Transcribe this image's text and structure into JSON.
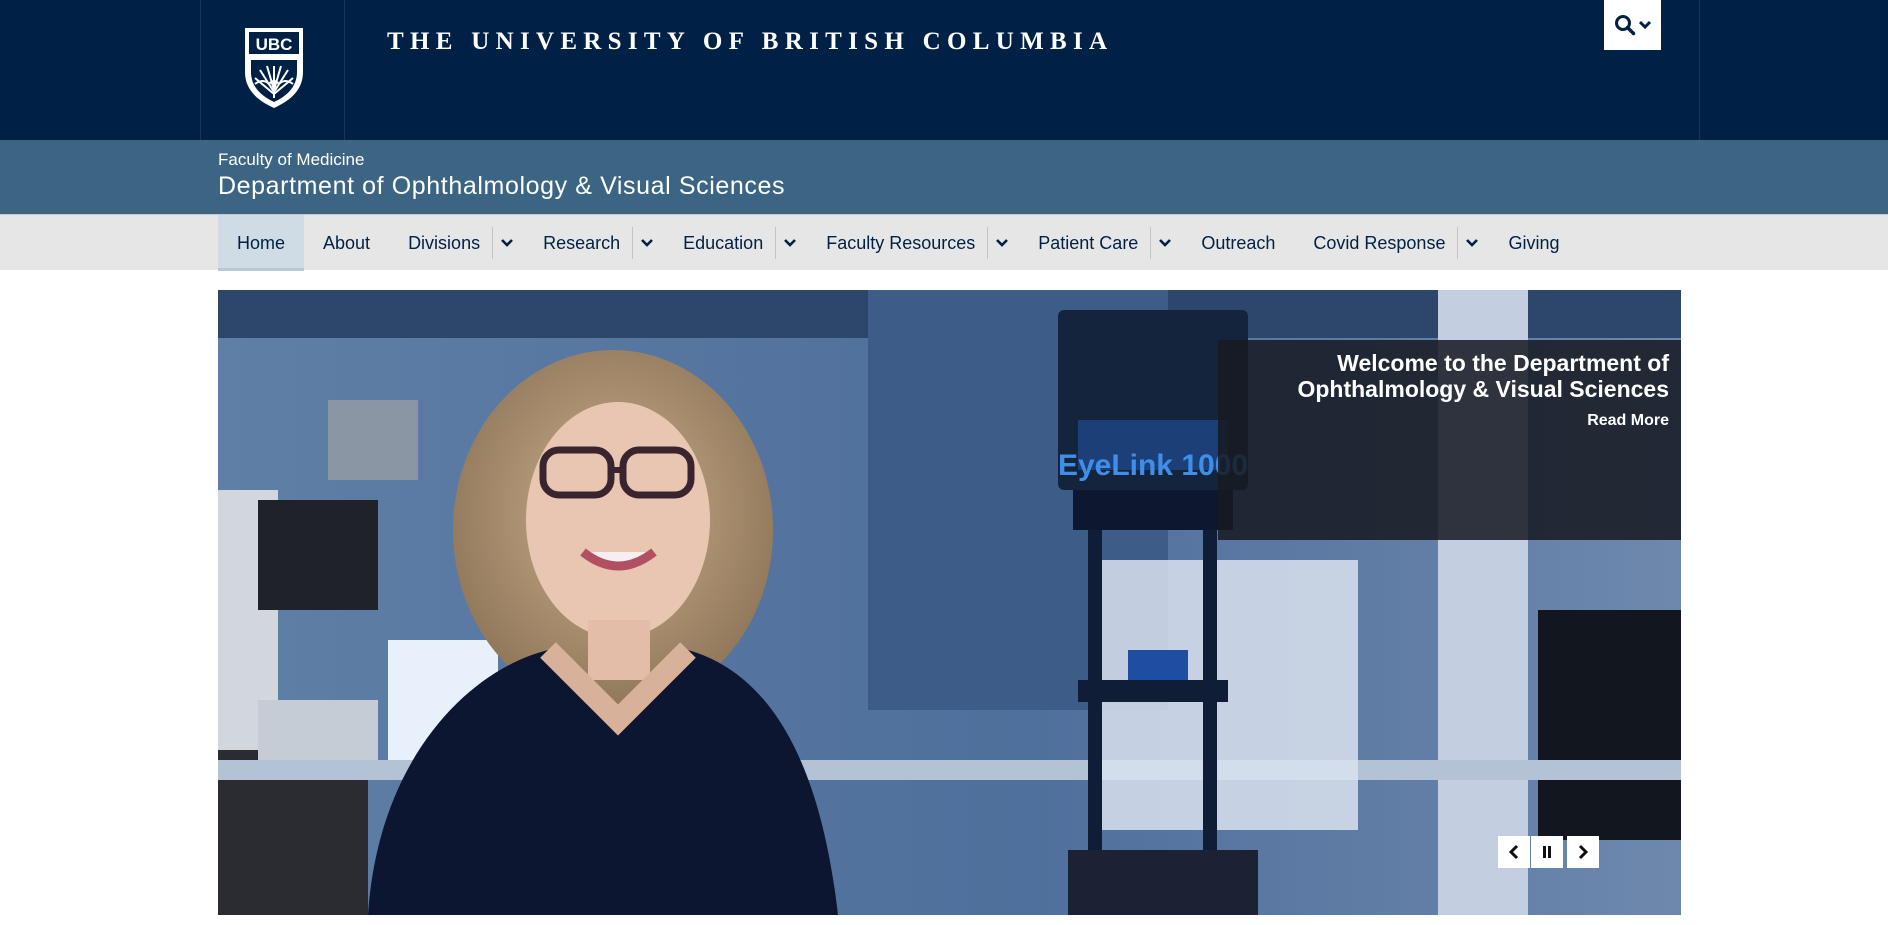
{
  "ubc": {
    "wordmark": "THE UNIVERSITY OF BRITISH COLUMBIA",
    "crest_text": "UBC",
    "search_icon": "search-icon",
    "search_caret_icon": "chevron-down-icon"
  },
  "unit": {
    "faculty": "Faculty of Medicine",
    "department": "Department of Ophthalmology & Visual Sciences"
  },
  "nav": {
    "items": [
      {
        "label": "Home",
        "active": true,
        "submenu": false
      },
      {
        "label": "About",
        "submenu": false
      },
      {
        "label": "Divisions",
        "submenu": true
      },
      {
        "label": "Research",
        "submenu": true
      },
      {
        "label": "Education",
        "submenu": true
      },
      {
        "label": "Faculty Resources",
        "submenu": true
      },
      {
        "label": "Patient Care",
        "submenu": true
      },
      {
        "label": "Outreach",
        "submenu": false
      },
      {
        "label": "Covid Response",
        "submenu": true
      },
      {
        "label": "Giving",
        "submenu": false
      }
    ]
  },
  "hero": {
    "caption_title": "Welcome to the Department of Ophthalmology & Visual Sciences",
    "read_more": "Read More",
    "device_label": "EyeLink 1000",
    "controls": [
      "chevron-left-icon",
      "pause-icon",
      "chevron-right-icon"
    ]
  },
  "colors": {
    "ubc_navy": "#002145",
    "unit_blue": "#3b6583",
    "nav_gray": "#e6e6e6",
    "active_tab": "#cfdbe5"
  }
}
